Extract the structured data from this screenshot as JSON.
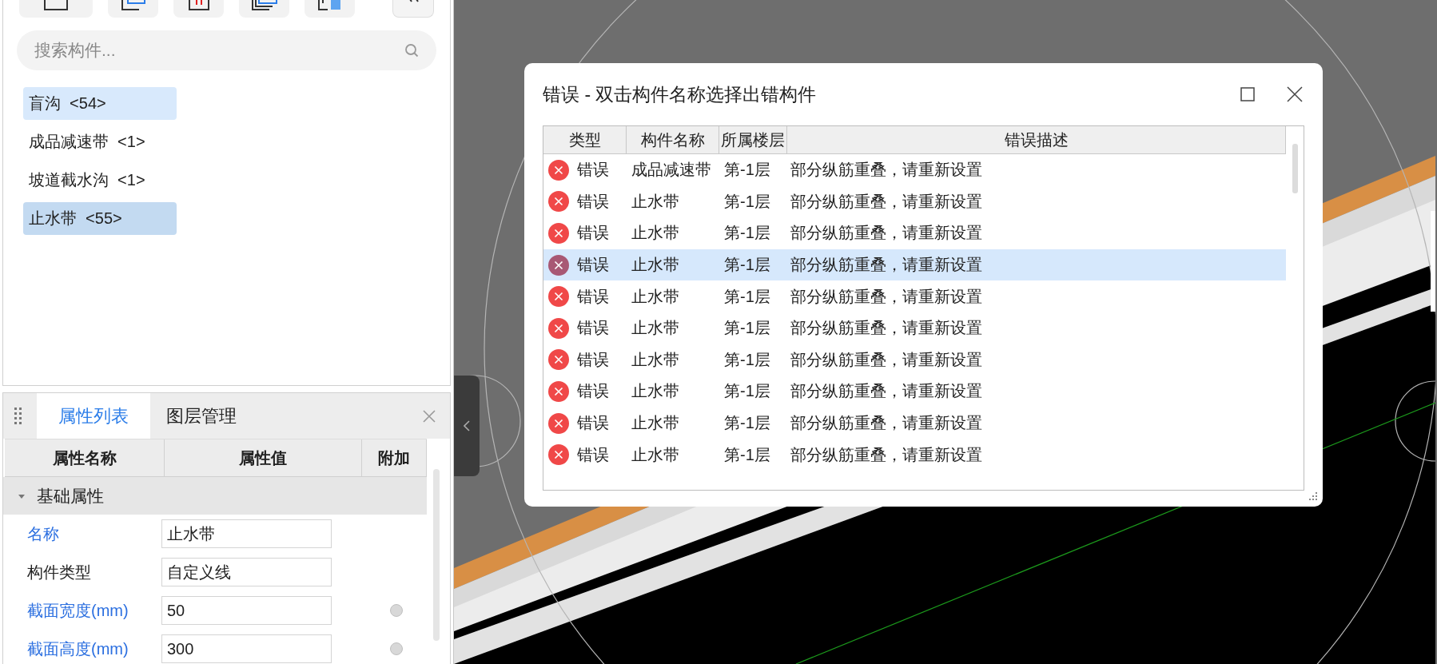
{
  "search": {
    "placeholder": "搜索构件..."
  },
  "components": [
    {
      "label": "盲沟",
      "count": "<54>",
      "selected": false,
      "hovered": true
    },
    {
      "label": "成品减速带",
      "count": "<1>",
      "selected": false,
      "hovered": false
    },
    {
      "label": "坡道截水沟",
      "count": "<1>",
      "selected": false,
      "hovered": false
    },
    {
      "label": "止水带",
      "count": "<55>",
      "selected": true,
      "hovered": false
    }
  ],
  "properties_panel": {
    "tabs": [
      {
        "label": "属性列表",
        "selected": true
      },
      {
        "label": "图层管理",
        "selected": false
      }
    ],
    "columns": [
      "属性名称",
      "属性值",
      "附加"
    ],
    "group": {
      "label": "基础属性",
      "expanded": true
    },
    "rows": [
      {
        "name": "名称",
        "value": "止水带",
        "public": true,
        "attached": false
      },
      {
        "name": "构件类型",
        "value": "自定义线",
        "public": false,
        "attached": false
      },
      {
        "name": "截面宽度(mm)",
        "value": "50",
        "public": true,
        "attached": true
      },
      {
        "name": "截面高度(mm)",
        "value": "300",
        "public": true,
        "attached": true
      }
    ]
  },
  "dialog": {
    "title": "错误 - 双击构件名称选择出错构件",
    "columns": [
      "类型",
      "构件名称",
      "所属楼层",
      "错误描述"
    ],
    "rows": [
      {
        "type": "错误",
        "name": "成品减速带",
        "floor": "第-1层",
        "description": "部分纵筋重叠，请重新设置",
        "selected": false
      },
      {
        "type": "错误",
        "name": "止水带",
        "floor": "第-1层",
        "description": "部分纵筋重叠，请重新设置",
        "selected": false
      },
      {
        "type": "错误",
        "name": "止水带",
        "floor": "第-1层",
        "description": "部分纵筋重叠，请重新设置",
        "selected": false
      },
      {
        "type": "错误",
        "name": "止水带",
        "floor": "第-1层",
        "description": "部分纵筋重叠，请重新设置",
        "selected": true
      },
      {
        "type": "错误",
        "name": "止水带",
        "floor": "第-1层",
        "description": "部分纵筋重叠，请重新设置",
        "selected": false
      },
      {
        "type": "错误",
        "name": "止水带",
        "floor": "第-1层",
        "description": "部分纵筋重叠，请重新设置",
        "selected": false
      },
      {
        "type": "错误",
        "name": "止水带",
        "floor": "第-1层",
        "description": "部分纵筋重叠，请重新设置",
        "selected": false
      },
      {
        "type": "错误",
        "name": "止水带",
        "floor": "第-1层",
        "description": "部分纵筋重叠，请重新设置",
        "selected": false
      },
      {
        "type": "错误",
        "name": "止水带",
        "floor": "第-1层",
        "description": "部分纵筋重叠，请重新设置",
        "selected": false
      },
      {
        "type": "错误",
        "name": "止水带",
        "floor": "第-1层",
        "description": "部分纵筋重叠，请重新设置",
        "selected": false
      }
    ]
  }
}
